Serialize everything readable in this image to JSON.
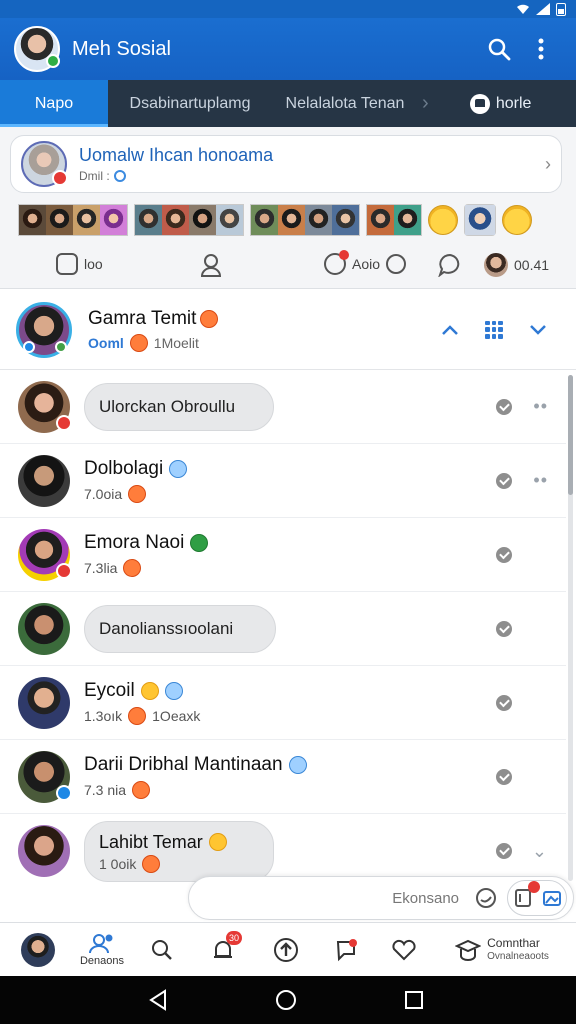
{
  "app": {
    "title": "Meh Sosial"
  },
  "tabs": [
    {
      "label": "Napo",
      "active": true
    },
    {
      "label": "Dsabinartuplamg",
      "active": false
    },
    {
      "label": "Nelalalota Tenan",
      "active": false
    },
    {
      "label": "horle",
      "active": false
    }
  ],
  "status_card": {
    "title": "Uomalw Ihcan honoama",
    "subtitle": "Dmil :"
  },
  "actions": [
    {
      "label": "loo",
      "icon": "bookmark-icon"
    },
    {
      "label": "",
      "icon": "profile-icon"
    },
    {
      "label": "Aoio",
      "icon": "edit-icon"
    },
    {
      "label": "",
      "icon": "comment-icon"
    },
    {
      "label": "00.41",
      "icon": "avatar"
    }
  ],
  "group": {
    "name": "Gamra Temit",
    "handle": "Ooml",
    "sub": "1Moelit"
  },
  "chats": [
    {
      "name": "",
      "bubble": "Ulorckan Obroullu",
      "sub": "",
      "emoji": ""
    },
    {
      "name": "Dolbolagi",
      "bubble": "",
      "sub": "7.0oia",
      "emoji": ""
    },
    {
      "name": "Emora Naoi",
      "bubble": "",
      "sub": "7.3lia",
      "emoji": ""
    },
    {
      "name": "",
      "bubble": "Danolianssıoolani",
      "sub": "",
      "emoji": ""
    },
    {
      "name": "Eycoil",
      "bubble": "",
      "sub": "1.3oık",
      "sub2": "1Oeaxk",
      "emoji": ""
    },
    {
      "name": "Darii Dribhal Mantinaan",
      "bubble": "",
      "sub": "7.3 nia",
      "emoji": ""
    },
    {
      "name": "Lahibt Temar",
      "bubble": "",
      "sub": "1 0oik",
      "emoji": ""
    }
  ],
  "compose": {
    "placeholder": "Ekonsano"
  },
  "bottom_nav": [
    {
      "label": "",
      "icon": "profile-avatar"
    },
    {
      "label": "Denaons",
      "icon": "people-icon"
    },
    {
      "label": "",
      "icon": "search-icon"
    },
    {
      "label": "",
      "icon": "bell-icon",
      "badge": "30"
    },
    {
      "label": "",
      "icon": "up-icon"
    },
    {
      "label": "",
      "icon": "flag-icon"
    },
    {
      "label": "",
      "icon": "heart-icon"
    },
    {
      "label": "Comnthar",
      "sublabel": "Ovnalneaoots",
      "icon": "graduate-icon"
    }
  ],
  "colors": {
    "primary": "#1a6ed0",
    "tab_bg": "#263545",
    "accent_blue": "#2f79d4",
    "badge_red": "#e53935"
  }
}
